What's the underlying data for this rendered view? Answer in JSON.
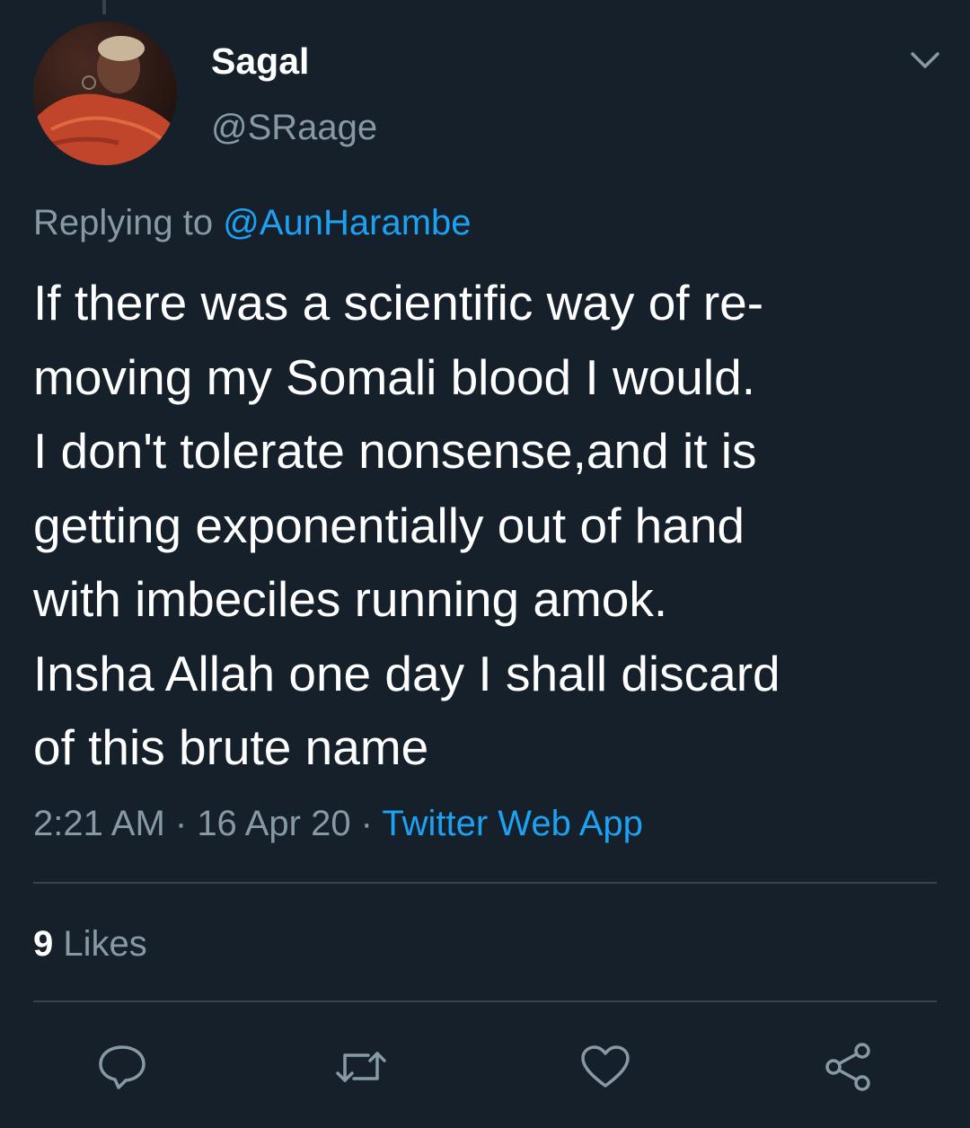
{
  "tweet": {
    "author": {
      "display_name": "Sagal",
      "handle": "@SRaage"
    },
    "replying_prefix": "Replying to ",
    "replying_to": "@AunHarambe",
    "text_lines": [
      "If there was a scientific way of re-",
      "moving my Somali blood I would.",
      "I don't tolerate nonsense,and it is",
      "getting exponentially out of hand",
      "with imbeciles running amok.",
      "Insha Allah one day I shall discard",
      "of this brute name"
    ],
    "time": "2:21 AM",
    "separator": " · ",
    "date": "16 Apr 20",
    "source": "Twitter Web App",
    "likes_count": "9",
    "likes_label": " Likes"
  },
  "icons": {
    "menu": "chevron-down-icon",
    "reply": "speech-bubble-icon",
    "retweet": "retweet-arrows-icon",
    "like": "heart-icon",
    "share": "share-nodes-icon"
  },
  "colors": {
    "background": "#15202b",
    "text_primary": "#ffffff",
    "text_secondary": "#8899a6",
    "accent": "#1da1f2",
    "divider": "#38444d"
  }
}
